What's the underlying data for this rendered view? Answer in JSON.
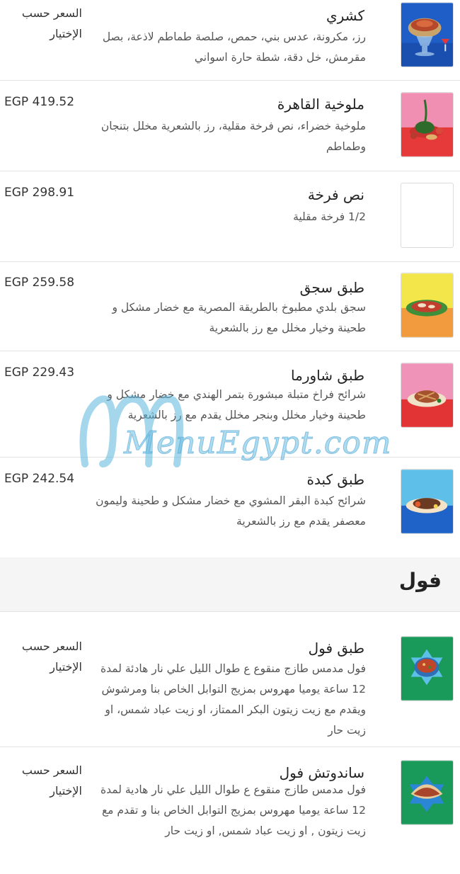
{
  "menu": {
    "items": [
      {
        "name": "كشري",
        "description": "رز، مكرونة، عدس بني، حمص، صلصة طماطم لاذعة، بصل مقرمش، خل دقة، شطة حارة اسواني",
        "price": "السعر حسب الإختيار",
        "image": "koshary-bowl"
      },
      {
        "name": "ملوخية القاهرة",
        "description": "ملوخية خضراء، نص فرخة مقلية، رز بالشعرية مخلل بتنجان وطماطم",
        "price": "EGP 419.52",
        "image": "molokhia-plate"
      },
      {
        "name": "نص فرخة",
        "description": "1/2 فرخة مقلية",
        "price": "EGP 298.91",
        "image": ""
      },
      {
        "name": "طبق سجق",
        "description": "سجق بلدي مطبوخ بالطريقة المصرية مع خضار مشكل و طحينة وخيار مخلل مع رز بالشعرية",
        "price": "EGP 259.58",
        "image": "sausage-plate"
      },
      {
        "name": "طبق شاورما",
        "description": "شرائح فراخ متبلة مبشورة بتمر الهندي مع خضار مشكل و طحينة وخيار مخلل وبنجر مخلل يقدم مع رز بالشعرية",
        "price": "EGP 229.43",
        "image": "shawarma-plate"
      },
      {
        "name": "طبق كبدة",
        "description": "شرائح كبدة البقر المشوي مع خضار مشكل و طحينة وليمون معصفر يقدم مع رز بالشعرية",
        "price": "EGP 242.54",
        "image": "liver-plate"
      }
    ],
    "section": {
      "title": "فول",
      "items": [
        {
          "name": "طبق فول",
          "description": "فول مدمس طازج منقوع ع طوال الليل علي نار هادئة لمدة 12 ساعة يوميا مهروس بمزيج التوابل الخاص بنا ومرشوش ويقدم مع زيت زيتون البكر الممتاز، او زيت عباد شمس، او زيت حار",
          "price": "السعر حسب الإختيار",
          "image": "foul-bowl"
        },
        {
          "name": "ساندوتش فول",
          "description": "فول مدمس طازج منقوع ع طوال الليل علي نار هادية لمدة 12 ساعة يوميا مهروس بمزيج التوابل الخاص بنا و تقدم مع زيت زيتون , او زيت عباد شمس, او زيت حار",
          "price": "السعر حسب الإختيار",
          "image": "foul-sandwich"
        }
      ]
    }
  },
  "watermark": {
    "text": "MenuEgypt.com"
  }
}
